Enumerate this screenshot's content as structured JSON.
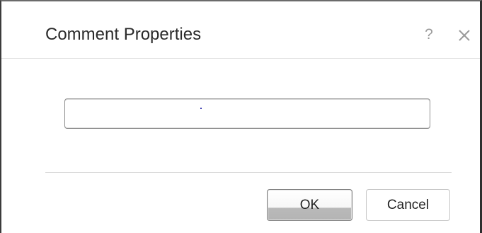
{
  "dialog": {
    "title": "Comment Properties",
    "help_symbol": "?",
    "close_icon": "close-icon"
  },
  "comment_input": {
    "value": "",
    "placeholder": ""
  },
  "buttons": {
    "ok_label": "OK",
    "cancel_label": "Cancel"
  }
}
